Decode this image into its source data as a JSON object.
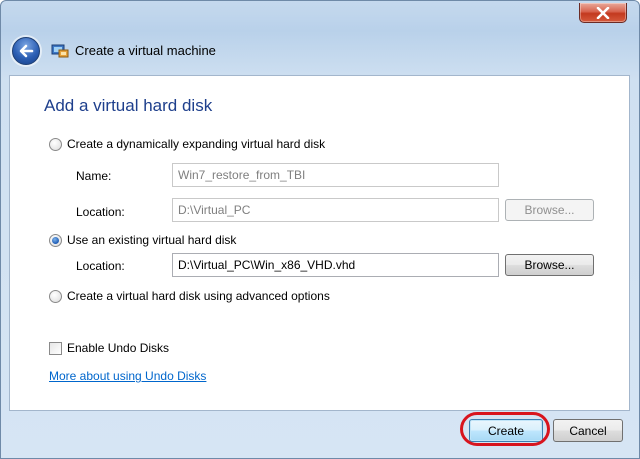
{
  "window": {
    "title": "Create a virtual machine"
  },
  "icons": {
    "back": "back-arrow-icon",
    "app": "virtual-pc-icon",
    "close": "close-icon"
  },
  "page": {
    "heading": "Add a virtual hard disk"
  },
  "options": {
    "dynamic": {
      "label": "Create a dynamically expanding virtual hard disk",
      "checked": false,
      "name_label": "Name:",
      "name_value": "Win7_restore_from_TBI",
      "location_label": "Location:",
      "location_value": "D:\\Virtual_PC",
      "browse_label": "Browse..."
    },
    "existing": {
      "label": "Use an existing virtual hard disk",
      "checked": true,
      "location_label": "Location:",
      "location_value": "D:\\Virtual_PC\\Win_x86_VHD.vhd",
      "browse_label": "Browse..."
    },
    "advanced": {
      "label": "Create a virtual hard disk using advanced options",
      "checked": false
    }
  },
  "undo": {
    "checkbox_label": "Enable Undo Disks",
    "checked": false,
    "link_text": "More about using Undo Disks"
  },
  "footer": {
    "create_label": "Create",
    "cancel_label": "Cancel"
  },
  "colors": {
    "heading": "#1e3f8c",
    "link": "#0066cc",
    "highlight": "#d8141e"
  }
}
